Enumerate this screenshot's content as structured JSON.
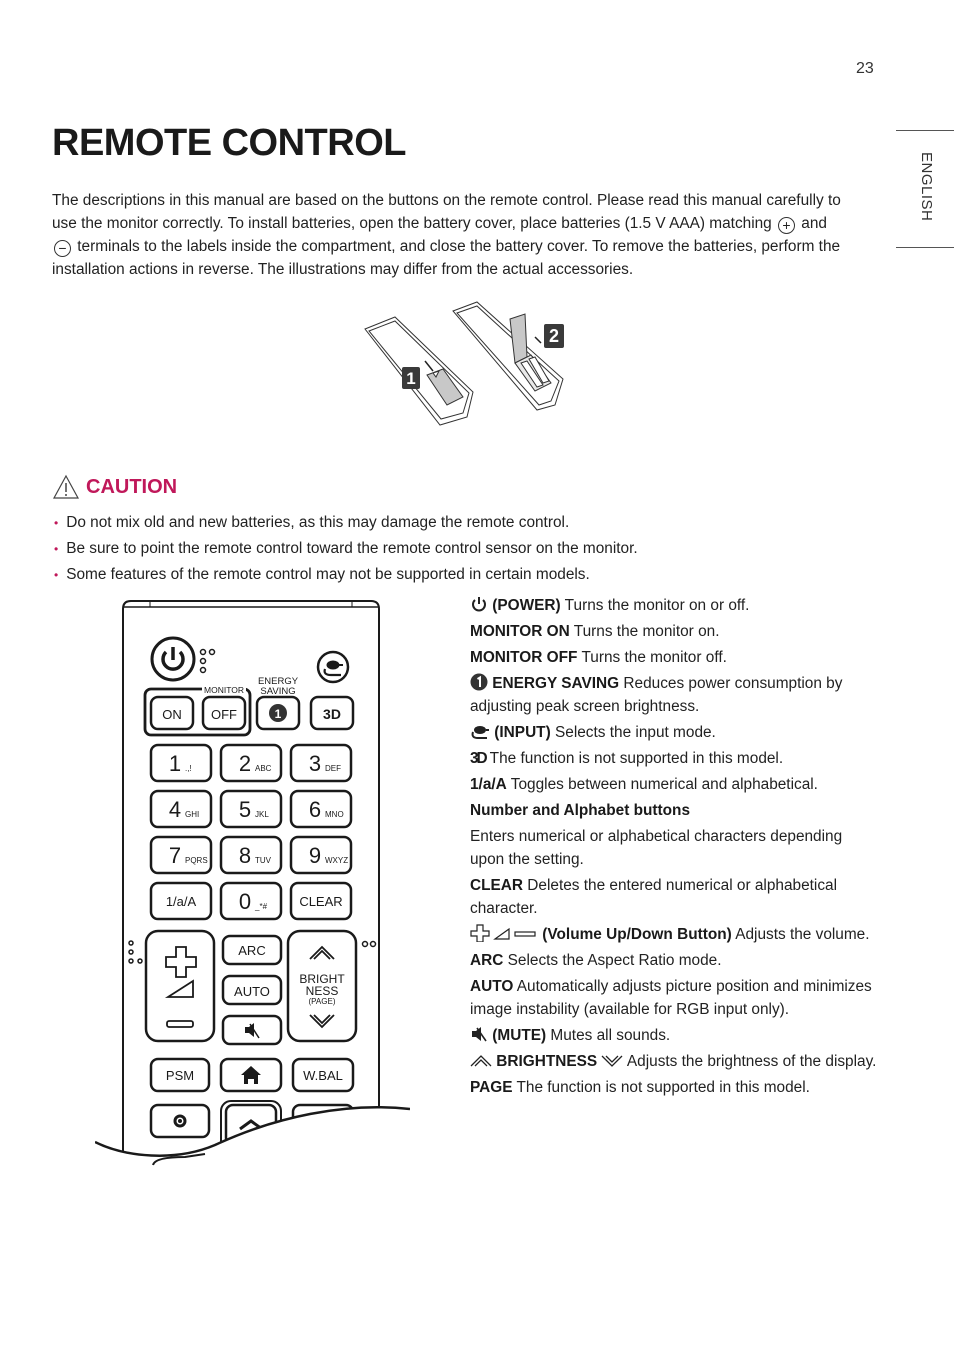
{
  "page": {
    "number": "23",
    "language_tab": "ENGLISH",
    "title": "REMOTE CONTROL"
  },
  "intro": {
    "part1": "The descriptions in this manual are based on the buttons on the remote control. Please read this manual carefully to use the monitor correctly. To install batteries, open the battery cover, place batteries (1.5 V AAA) matching ",
    "plus_symbol": "+",
    "part2": " and ",
    "minus_symbol": "−",
    "part3": " terminals to the labels inside the compartment, and close the battery cover. To remove the batteries, perform the installation actions in reverse. The illustrations may differ from the actual accessories."
  },
  "battery_illustration": {
    "step1": "1",
    "step2": "2"
  },
  "caution": {
    "heading": "CAUTION",
    "items": [
      "Do not mix old and new batteries, as this may damage the remote control.",
      "Be sure to point the remote control toward the remote control sensor on the monitor.",
      "Some features of the remote control may not be supported in certain models."
    ]
  },
  "remote": {
    "monitor_label": "MONITOR",
    "on": "ON",
    "off": "OFF",
    "energy_saving_line1": "ENERGY",
    "energy_saving_line2": "SAVING",
    "energy_saving_glyph": "1",
    "three_d": "3D",
    "keys": [
      {
        "num": "1",
        "sub": ".,!"
      },
      {
        "num": "2",
        "sub": "ABC"
      },
      {
        "num": "3",
        "sub": "DEF"
      },
      {
        "num": "4",
        "sub": "GHI"
      },
      {
        "num": "5",
        "sub": "JKL"
      },
      {
        "num": "6",
        "sub": "MNO"
      },
      {
        "num": "7",
        "sub": "PQRS"
      },
      {
        "num": "8",
        "sub": "TUV"
      },
      {
        "num": "9",
        "sub": "WXYZ"
      },
      {
        "num": "0",
        "sub": "_*#"
      }
    ],
    "mode_key": "1/a/A",
    "clear": "CLEAR",
    "arc": "ARC",
    "auto": "AUTO",
    "bright1": "BRIGHT",
    "bright2": "NESS",
    "page": "(PAGE)",
    "psm": "PSM",
    "wbal": "W.BAL"
  },
  "descriptions": {
    "power_label": "(POWER)",
    "power_text": " Turns the monitor on or off.",
    "monitor_on_label": "MONITOR ON",
    "monitor_on_text": " Turns the monitor on.",
    "monitor_off_label": "MONITOR OFF",
    "monitor_off_text": " Turns the monitor off.",
    "energy_label": "ENERGY SAVING",
    "energy_text": " Reduces power consumption by adjusting peak screen brightness.",
    "input_label": "(INPUT)",
    "input_text": " Selects the input mode.",
    "three_d_text": " The function is not supported in this model.",
    "mode_label": "1/a/A",
    "mode_text": " Toggles between numerical and alphabetical.",
    "numbers_heading": "Number and Alphabet buttons",
    "numbers_text": "Enters numerical or alphabetical characters depending upon the setting.",
    "clear_label": "CLEAR",
    "clear_text": " Deletes the entered numerical or alphabetical character.",
    "volume_label": "(Volume Up/Down Button)",
    "volume_text": " Adjusts the volume.",
    "arc_label": "ARC",
    "arc_text": " Selects the Aspect Ratio mode.",
    "auto_label": "AUTO",
    "auto_text": " Automatically adjusts picture position and minimizes image instability (available for RGB input only).",
    "mute_label": "(MUTE)",
    "mute_text": " Mutes all sounds.",
    "brightness_label": "BRIGHTNESS",
    "brightness_text": " Adjusts the brightness of the display.",
    "page_label": "PAGE",
    "page_text": " The function is not supported in this model."
  },
  "colors": {
    "accent": "#c0185a",
    "text": "#222222"
  }
}
